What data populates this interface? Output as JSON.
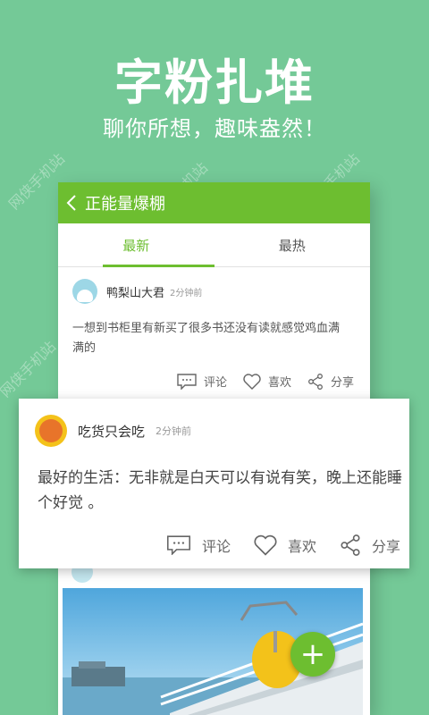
{
  "promo": {
    "title": "字粉扎堆",
    "subtitle": "聊你所想，趣味盎然！",
    "watermark": "网侠手机站"
  },
  "app_bar": {
    "title": "正能量爆棚"
  },
  "tabs": [
    {
      "label": "最新",
      "active": true
    },
    {
      "label": "最热",
      "active": false
    }
  ],
  "post1": {
    "username": "鸭梨山大君",
    "time": "2分钟前",
    "content": "一想到书柜里有新买了很多书还没有读就感觉鸡血满满的",
    "actions": {
      "comment": "评论",
      "like": "喜欢",
      "share": "分享"
    }
  },
  "post2": {
    "username": "吃货只会吃",
    "time": "2分钟前",
    "content": "最好的生活：无非就是白天可以有说有笑，晚上还能睡个好觉 。",
    "actions": {
      "comment": "评论",
      "like": "喜欢",
      "share": "分享"
    }
  },
  "colors": {
    "background": "#74c997",
    "accent": "#6dbe30"
  },
  "icons": {
    "back": "chevron-left-icon",
    "comment": "comment-icon",
    "like": "heart-icon",
    "share": "share-icon",
    "add": "plus-icon"
  }
}
